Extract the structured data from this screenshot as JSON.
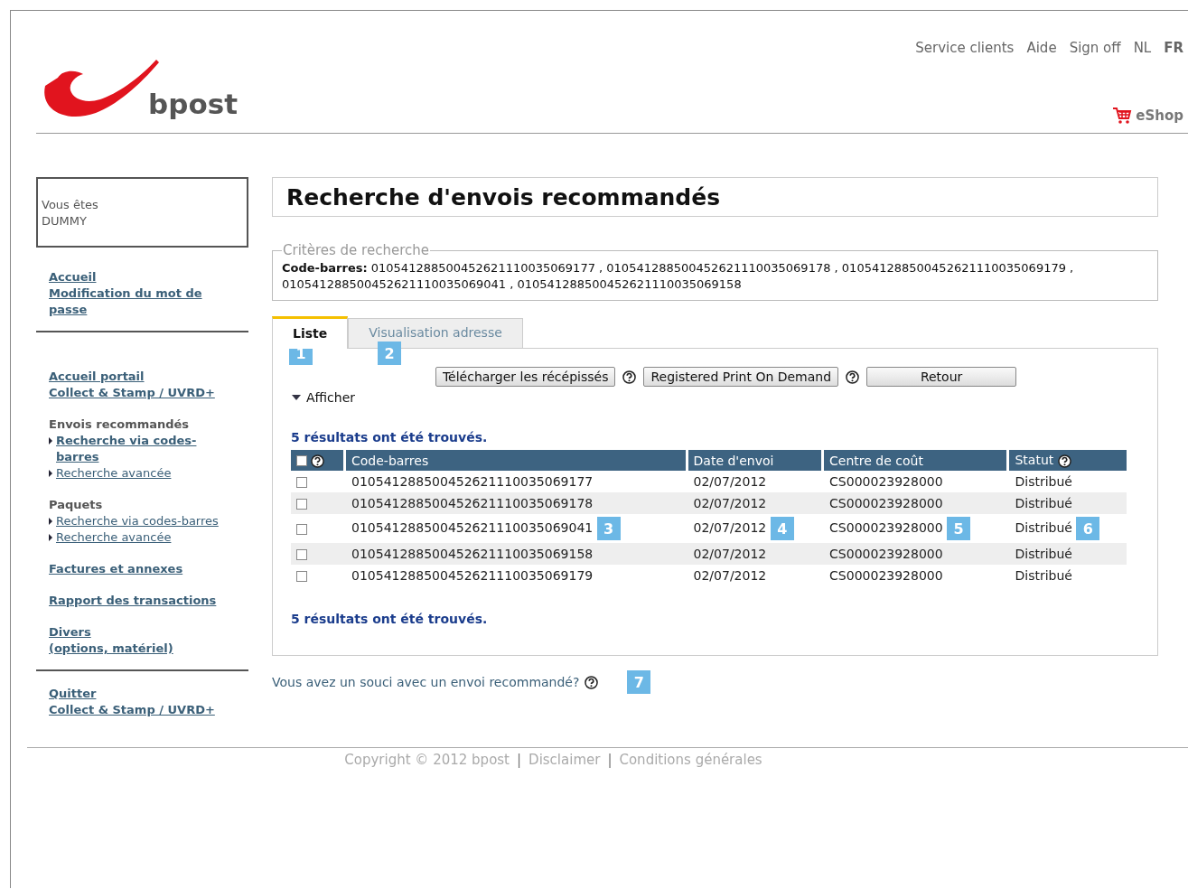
{
  "header": {
    "logo_text": "bpost",
    "links": [
      {
        "text": "Service clients"
      },
      {
        "text": "Aide"
      },
      {
        "text": "Sign off"
      }
    ],
    "languages": [
      {
        "code": "NL",
        "selected": false
      },
      {
        "code": "FR",
        "selected": true
      }
    ],
    "eshop": "eShop"
  },
  "sidebar": {
    "user_label": "Vous êtes",
    "user_name": "DUMMY",
    "sections": [
      [
        [
          {
            "kind": "link",
            "text": "Accueil "
          },
          {
            "kind": "link",
            "text": "Modification du mot de passe "
          }
        ]
      ],
      [
        [
          {
            "kind": "link",
            "text": "Accueil portail"
          },
          {
            "kind": "link",
            "text": "Collect & Stamp / UVRD+"
          }
        ],
        [
          {
            "kind": "heading",
            "text": "Envois recommandés"
          },
          {
            "kind": "sublink",
            "text": "Recherche via codes-barres",
            "selected": true
          },
          {
            "kind": "sublink",
            "text": "Recherche avancée",
            "selected": false
          }
        ],
        [
          {
            "kind": "heading",
            "text": "Paquets"
          },
          {
            "kind": "sublink",
            "text": "Recherche via codes-barres",
            "selected": false
          },
          {
            "kind": "sublink",
            "text": "Recherche avancée",
            "selected": false
          }
        ],
        [
          {
            "kind": "link",
            "text": "Factures et annexes"
          }
        ],
        [
          {
            "kind": "link",
            "text": "Rapport des transactions"
          }
        ],
        [
          {
            "kind": "link",
            "text": "Divers"
          },
          {
            "kind": "link",
            "text": "(options, matériel)"
          }
        ]
      ],
      [
        [
          {
            "kind": "link",
            "text": "Quitter"
          },
          {
            "kind": "link",
            "text": "Collect & Stamp / UVRD+"
          }
        ]
      ]
    ]
  },
  "page_title": "Recherche d'envois recommandés",
  "criteria": {
    "legend": "Critères de recherche",
    "text": "**Code-barres:** 010541288500452621110035069177 , 010541288500452621110035069178 , 010541288500452621110035069179 , 010541288500452621110035069041 , 010541288500452621110035069158"
  },
  "tabs": [
    {
      "label": "Liste",
      "selected": true,
      "marker": "1"
    },
    {
      "label": "Visualisation adresse",
      "selected": false,
      "marker": "2"
    }
  ],
  "buttons": [
    {
      "label": "Télécharger les récépissés",
      "help": true
    },
    {
      "label": "Registered Print On Demand",
      "help": true
    },
    {
      "label": "Retour",
      "help": false
    }
  ],
  "toggle": {
    "label": "Afficher",
    "expanded": false
  },
  "results_top": "5 résultats ont été trouvés.",
  "table": {
    "select_all": {
      "checked": false
    },
    "columns": [
      {
        "label": "Code-barres",
        "help": false
      },
      {
        "label": "Date d'envoi",
        "help": false
      },
      {
        "label": "Centre de coût",
        "help": false
      },
      {
        "label": "Statut",
        "help": true
      }
    ],
    "rows": [
      {
        "checked": false,
        "cells": [
          {
            "text": "010541288500452621110035069177"
          },
          {
            "text": "02/07/2012"
          },
          {
            "text": "CS000023928000"
          },
          {
            "text": "Distribué"
          }
        ]
      },
      {
        "checked": false,
        "cells": [
          {
            "text": "010541288500452621110035069178"
          },
          {
            "text": "02/07/2012"
          },
          {
            "text": "CS000023928000"
          },
          {
            "text": "Distribué"
          }
        ]
      },
      {
        "checked": false,
        "cells": [
          {
            "text": "010541288500452621110035069041",
            "marker": "3"
          },
          {
            "text": "02/07/2012",
            "marker": "4"
          },
          {
            "text": "CS000023928000",
            "marker": "5"
          },
          {
            "text": "Distribué",
            "marker": "6"
          }
        ]
      },
      {
        "checked": false,
        "cells": [
          {
            "text": "010541288500452621110035069158"
          },
          {
            "text": "02/07/2012"
          },
          {
            "text": "CS000023928000"
          },
          {
            "text": "Distribué"
          }
        ]
      },
      {
        "checked": false,
        "cells": [
          {
            "text": "010541288500452621110035069179"
          },
          {
            "text": "02/07/2012"
          },
          {
            "text": "CS000023928000"
          },
          {
            "text": "Distribué"
          }
        ]
      }
    ]
  },
  "results_bottom": "5 résultats ont été trouvés.",
  "question": {
    "text": "Vous avez un souci avec un envoi recommandé?",
    "marker": "7"
  },
  "footer": [
    {
      "kind": "link",
      "text": "Copyright © 2012 bpost"
    },
    {
      "kind": "separator",
      "text": "|"
    },
    {
      "kind": "link",
      "text": "Disclaimer"
    },
    {
      "kind": "separator",
      "text": "|"
    },
    {
      "kind": "link",
      "text": "Conditions générales"
    }
  ]
}
